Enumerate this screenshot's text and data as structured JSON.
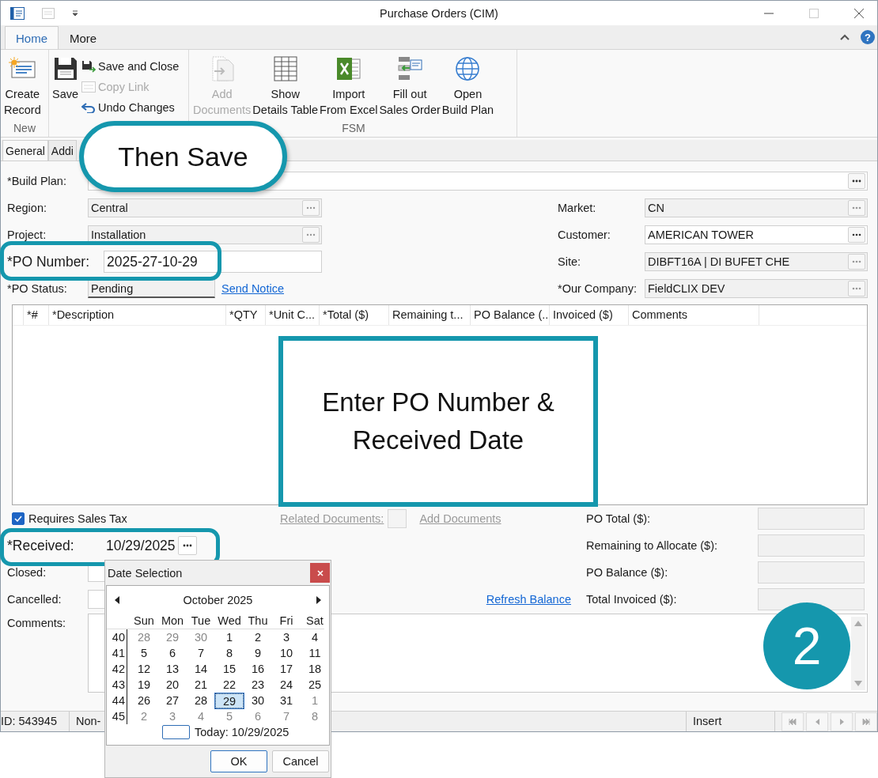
{
  "window": {
    "title": "Purchase Orders (CIM)",
    "help": "?"
  },
  "ribbon": {
    "tabs": [
      {
        "label": "Home",
        "selected": true
      },
      {
        "label": "More",
        "selected": false
      }
    ],
    "new_group": {
      "label": "New",
      "button": {
        "lines": [
          "Create",
          "Record"
        ],
        "disabled": false
      }
    },
    "save_group": {
      "save": {
        "lines": [
          "Save"
        ],
        "disabled": false
      },
      "small_buttons": [
        {
          "label": "Save and Close",
          "disabled": false
        },
        {
          "label": "Copy Link",
          "disabled": true
        },
        {
          "label": "Undo Changes",
          "disabled": false
        }
      ]
    },
    "fsm_group": {
      "label": "FSM",
      "buttons": [
        {
          "lines": [
            "Add",
            "Documents"
          ],
          "disabled": true
        },
        {
          "lines": [
            "Show",
            "Details Table"
          ],
          "disabled": false
        },
        {
          "lines": [
            "Import",
            "From Excel"
          ],
          "disabled": false
        },
        {
          "lines": [
            "Fill out",
            "Sales Order"
          ],
          "disabled": false
        },
        {
          "lines": [
            "Open",
            "Build Plan"
          ],
          "disabled": false
        }
      ]
    }
  },
  "form_tabs": [
    {
      "label": "General",
      "selected": true
    },
    {
      "label": "Addi",
      "selected": false
    }
  ],
  "form": {
    "build_plan": {
      "label": "*Build Plan:",
      "readonly": false
    },
    "left": [
      {
        "kind": "lookup",
        "label": "Region:",
        "value": "Central",
        "readonly": true,
        "highlighted": false
      },
      {
        "kind": "lookup",
        "label": "Project:",
        "value": "Installation",
        "readonly": true,
        "highlighted": false
      },
      {
        "kind": "text",
        "label": "*PO Number:",
        "value": "2025-27-10-29",
        "readonly": false,
        "highlighted": true
      },
      {
        "kind": "status",
        "label": "*PO Status:",
        "value": "Pending",
        "readonly": true,
        "highlighted": false,
        "link": "Send Notice"
      }
    ],
    "right": [
      {
        "label": "Market:",
        "value": "CN",
        "readonly": true
      },
      {
        "label": "Customer:",
        "value": "AMERICAN TOWER",
        "readonly": false
      },
      {
        "label": "Site:",
        "value": "DIBFT16A | DI BUFET CHE",
        "readonly": true
      },
      {
        "label": "*Our Company:",
        "value": "FieldCLIX DEV",
        "readonly": true
      }
    ]
  },
  "details_table": {
    "columns": [
      "*#",
      "*Description",
      "*QTY",
      "*Unit C...",
      "*Total ($)",
      "Remaining t...",
      "PO Balance (...",
      "Invoiced ($)",
      "Comments"
    ]
  },
  "bottom": {
    "sales_tax": {
      "label": "Requires Sales Tax",
      "checked": true
    },
    "related": {
      "label": "Related Documents:",
      "link": "Add Documents",
      "disabled": true
    },
    "left": [
      {
        "kind": "date",
        "label": "*Received:",
        "value": "10/29/2025",
        "highlighted": true
      },
      {
        "kind": "blank",
        "label": "Closed:",
        "highlighted": false
      },
      {
        "kind": "blank",
        "label": "Cancelled:",
        "highlighted": false
      }
    ],
    "refresh_link": "Refresh Balance",
    "totals": [
      "PO Total ($):",
      "Remaining to Allocate ($):",
      "PO Balance ($):",
      "Total Invoiced ($):"
    ],
    "comments": {
      "label": "Comments:"
    }
  },
  "status_bar": {
    "cells": [
      "ID: 543945",
      "Non-"
    ],
    "mode": "Insert"
  },
  "date_popup": {
    "title": "Date Selection",
    "month": "October 2025",
    "weekdays": [
      "Sun",
      "Mon",
      "Tue",
      "Wed",
      "Thu",
      "Fri",
      "Sat"
    ],
    "weeks": [
      {
        "week": "40",
        "days": [
          {
            "d": "28",
            "muted": true,
            "selected": false
          },
          {
            "d": "29",
            "muted": true,
            "selected": false
          },
          {
            "d": "30",
            "muted": true,
            "selected": false
          },
          {
            "d": "1",
            "muted": false,
            "selected": false
          },
          {
            "d": "2",
            "muted": false,
            "selected": false
          },
          {
            "d": "3",
            "muted": false,
            "selected": false
          },
          {
            "d": "4",
            "muted": false,
            "selected": false
          }
        ]
      },
      {
        "week": "41",
        "days": [
          {
            "d": "5",
            "muted": false,
            "selected": false
          },
          {
            "d": "6",
            "muted": false,
            "selected": false
          },
          {
            "d": "7",
            "muted": false,
            "selected": false
          },
          {
            "d": "8",
            "muted": false,
            "selected": false
          },
          {
            "d": "9",
            "muted": false,
            "selected": false
          },
          {
            "d": "10",
            "muted": false,
            "selected": false
          },
          {
            "d": "11",
            "muted": false,
            "selected": false
          }
        ]
      },
      {
        "week": "42",
        "days": [
          {
            "d": "12",
            "muted": false,
            "selected": false
          },
          {
            "d": "13",
            "muted": false,
            "selected": false
          },
          {
            "d": "14",
            "muted": false,
            "selected": false
          },
          {
            "d": "15",
            "muted": false,
            "selected": false
          },
          {
            "d": "16",
            "muted": false,
            "selected": false
          },
          {
            "d": "17",
            "muted": false,
            "selected": false
          },
          {
            "d": "18",
            "muted": false,
            "selected": false
          }
        ]
      },
      {
        "week": "43",
        "days": [
          {
            "d": "19",
            "muted": false,
            "selected": false
          },
          {
            "d": "20",
            "muted": false,
            "selected": false
          },
          {
            "d": "21",
            "muted": false,
            "selected": false
          },
          {
            "d": "22",
            "muted": false,
            "selected": false
          },
          {
            "d": "23",
            "muted": false,
            "selected": false
          },
          {
            "d": "24",
            "muted": false,
            "selected": false
          },
          {
            "d": "25",
            "muted": false,
            "selected": false
          }
        ]
      },
      {
        "week": "44",
        "days": [
          {
            "d": "26",
            "muted": false,
            "selected": false
          },
          {
            "d": "27",
            "muted": false,
            "selected": false
          },
          {
            "d": "28",
            "muted": false,
            "selected": false
          },
          {
            "d": "29",
            "muted": false,
            "selected": true
          },
          {
            "d": "30",
            "muted": false,
            "selected": false
          },
          {
            "d": "31",
            "muted": false,
            "selected": false
          },
          {
            "d": "1",
            "muted": true,
            "selected": false
          }
        ]
      },
      {
        "week": "45",
        "days": [
          {
            "d": "2",
            "muted": true,
            "selected": false
          },
          {
            "d": "3",
            "muted": true,
            "selected": false
          },
          {
            "d": "4",
            "muted": true,
            "selected": false
          },
          {
            "d": "5",
            "muted": true,
            "selected": false
          },
          {
            "d": "6",
            "muted": true,
            "selected": false
          },
          {
            "d": "7",
            "muted": true,
            "selected": false
          },
          {
            "d": "8",
            "muted": true,
            "selected": false
          }
        ]
      }
    ],
    "today": "Today: 10/29/2025",
    "buttons": [
      {
        "label": "OK",
        "default": true
      },
      {
        "label": "Cancel",
        "default": false
      }
    ]
  },
  "callouts": [
    {
      "kind": "bubble",
      "text": "Then Save"
    },
    {
      "kind": "box",
      "text": "Enter PO Number & Received Date"
    },
    {
      "kind": "badge",
      "text": "2"
    }
  ]
}
